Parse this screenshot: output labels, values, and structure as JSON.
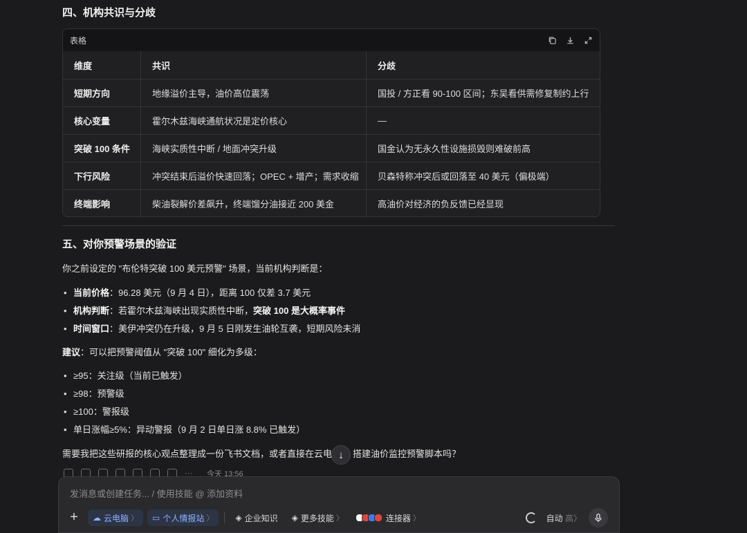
{
  "section4": {
    "title": "四、机构共识与分歧",
    "table_label": "表格",
    "header": [
      "维度",
      "共识",
      "分歧"
    ],
    "rows": [
      [
        "短期方向",
        "地缘溢价主导，油价高位震荡",
        "国投 / 方正看 90-100 区间；东吴看供需修复制约上行"
      ],
      [
        "核心变量",
        "霍尔木兹海峡通航状况是定价核心",
        "—"
      ],
      [
        "突破 100 条件",
        "海峡实质性中断 / 地面冲突升级",
        "国金认为无永久性设施损毁则难破前高"
      ],
      [
        "下行风险",
        "冲突结束后溢价快速回落；OPEC + 增产；需求收缩",
        "贝森特称冲突后或回落至 40 美元（偏极端）"
      ],
      [
        "终端影响",
        "柴油裂解价差飙升，终端馏分油接近 200 美金",
        "高油价对经济的负反馈已经显现"
      ]
    ]
  },
  "section5": {
    "title": "五、对你预警场景的验证",
    "intro": "你之前设定的 \"布伦特突破 100 美元预警\" 场景，当前机构判断是：",
    "bullets": [
      {
        "label": "当前价格",
        "sep": "：",
        "text": "96.28 美元（9 月 4 日），距离 100 仅差 3.7 美元",
        "bold_tail": ""
      },
      {
        "label": "机构判断",
        "sep": "：",
        "text": "若霍尔木兹海峡出现实质性中断，",
        "bold_tail": "突破 100 是大概率事件"
      },
      {
        "label": "时间窗口",
        "sep": "：",
        "text": "美伊冲突仍在升级，9 月 5 日刚发生油轮互袭，短期风险未消",
        "bold_tail": ""
      }
    ],
    "suggest_label": "建议",
    "suggest_text": "：可以把预警阈值从 \"突破 100\" 细化为多级：",
    "levels": [
      "≥95：关注级（当前已触发）",
      "≥98：预警级",
      "≥100：警报级",
      "单日涨幅≥5%：异动警报（9 月 2 日单日涨 8.8% 已触发）"
    ],
    "closing": "需要我把这些研报的核心观点整理成一份飞书文档，或者直接在云电",
    "closing_tail": "搭建油价监控预警脚本吗？"
  },
  "message_meta": {
    "time": "今天 13:56"
  },
  "composer": {
    "placeholder": "发消息或创建任务... / 使用技能 @ 添加资料",
    "chips": {
      "cloud_pc": "云电脑",
      "intel_station": "个人情报站",
      "enterprise": "企业知识",
      "more_skills": "更多技能",
      "connectors": "连接器",
      "auto_label": "自动",
      "auto_level": "高"
    },
    "arrow": "〉"
  },
  "colors": {
    "accent": "#8fb2ff",
    "bg": "#1b1b1d",
    "card": "#202023"
  }
}
